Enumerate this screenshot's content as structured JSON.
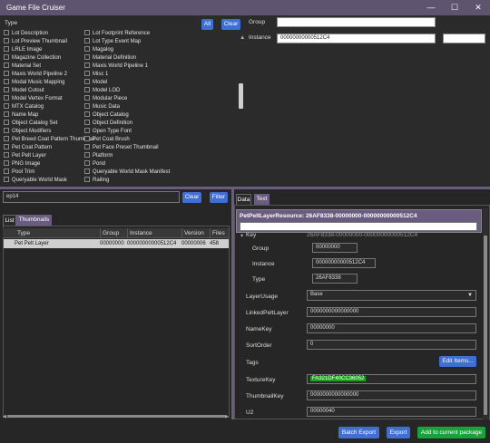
{
  "window": {
    "title": "Game File Cruiser",
    "minimize": "—",
    "maximize": "☐",
    "close": "✕"
  },
  "filter_panel": {
    "type_header": "Type",
    "all_button": "All",
    "clear_button": "Clear",
    "group_label": "Group",
    "group_value": "",
    "instance_label": "Instance",
    "instance_value": "00000000000512C4",
    "instance_extra": "",
    "col1": [
      {
        "label": "Lot Description",
        "checked": true
      },
      {
        "label": "Lot Preview Thumbnail",
        "checked": true
      },
      {
        "label": "LRLE Image",
        "checked": true
      },
      {
        "label": "Magazine Collection",
        "checked": true
      },
      {
        "label": "Material Set",
        "checked": true
      },
      {
        "label": "Maxis World Pipeline 2",
        "checked": true
      },
      {
        "label": "Modal Music Mapping",
        "checked": true
      },
      {
        "label": "Model Cutout",
        "checked": true
      },
      {
        "label": "Model Vertex Format",
        "checked": true
      },
      {
        "label": "MTX Catalog",
        "checked": true
      },
      {
        "label": "Name Map",
        "checked": true
      },
      {
        "label": "Object Catalog Set",
        "checked": true
      },
      {
        "label": "Object Modifiers",
        "checked": true
      },
      {
        "label": "Pet Breed Coat Pattern Thumbnail",
        "checked": true
      },
      {
        "label": "Pet Coat Pattern",
        "checked": true
      },
      {
        "label": "Pet Pelt Layer",
        "checked": true
      },
      {
        "label": "PNG Image",
        "checked": true
      },
      {
        "label": "Pool Trim",
        "checked": true
      },
      {
        "label": "Queryable World Mask",
        "checked": true
      }
    ],
    "col2": [
      {
        "label": "Lot Footprint Reference",
        "checked": true
      },
      {
        "label": "Lot Type Event Map",
        "checked": true
      },
      {
        "label": "Magalog",
        "checked": true
      },
      {
        "label": "Material Definition",
        "checked": true
      },
      {
        "label": "Maxis World Pipeline 1",
        "checked": true
      },
      {
        "label": "Misc 1",
        "checked": true
      },
      {
        "label": "Model",
        "checked": true
      },
      {
        "label": "Model LOD",
        "checked": true
      },
      {
        "label": "Modular Piece",
        "checked": true
      },
      {
        "label": "Music Data",
        "checked": true
      },
      {
        "label": "Object Catalog",
        "checked": true
      },
      {
        "label": "Object Definition",
        "checked": true
      },
      {
        "label": "Open Type Font",
        "checked": true
      },
      {
        "label": "Pet Coat Brush",
        "checked": true
      },
      {
        "label": "Pet Face Preset Thumbnail",
        "checked": true
      },
      {
        "label": "Platform",
        "checked": true
      },
      {
        "label": "Pond",
        "checked": true
      },
      {
        "label": "Queryable World Mask Manifest",
        "checked": true
      },
      {
        "label": "Railing",
        "checked": true
      }
    ]
  },
  "search": {
    "value": "ep14",
    "clear_button": "Clear",
    "filter_button": "Filter"
  },
  "left_tabs": {
    "list": "List",
    "thumbnails": "Thumbnails"
  },
  "grid": {
    "columns": [
      "Type",
      "Group",
      "Instance",
      "Version",
      "Files"
    ],
    "rows": [
      {
        "type": "Pet Pelt Layer",
        "group": "00000000",
        "instance": "00000000000512C4",
        "version": "00000006",
        "files": "458"
      }
    ]
  },
  "right_tabs": {
    "data": "Data",
    "text": "Text"
  },
  "resource": {
    "title": "PetPeltLayerResource: 26AF8338-00000000-00000000000512C4",
    "key_label": "Key",
    "key_value": "26AF8338-00000000-00000000000512C4",
    "group_label": "Group",
    "group_value": "00000000",
    "instance_label": "Instance",
    "instance_value": "00000000000512C4",
    "type_label": "Type",
    "type_value": "26AF8338",
    "layer_usage_label": "LayerUsage",
    "layer_usage_value": "Base",
    "linked_label": "LinkedPeltLayer",
    "linked_value": "0000000000000000",
    "namekey_label": "NameKey",
    "namekey_value": "00000000",
    "sortorder_label": "SortOrder",
    "sortorder_value": "0",
    "tags_label": "Tags",
    "edit_items_button": "Edit Items...",
    "texturekey_label": "TextureKey",
    "texturekey_value": "FA321DF40CC36052",
    "thumbnailkey_label": "ThumbnailKey",
    "thumbnailkey_value": "0000000000000000",
    "u2_label": "U2",
    "u2_value": "00000040"
  },
  "actions": {
    "batch_export": "Batch Export",
    "export": "Export",
    "add_to_package": "Add to current package"
  },
  "colors": {
    "accent": "#6a5c80",
    "button_blue": "#3f6fd1",
    "button_green": "#17a33a",
    "highlight_green": "#1aa31a"
  }
}
